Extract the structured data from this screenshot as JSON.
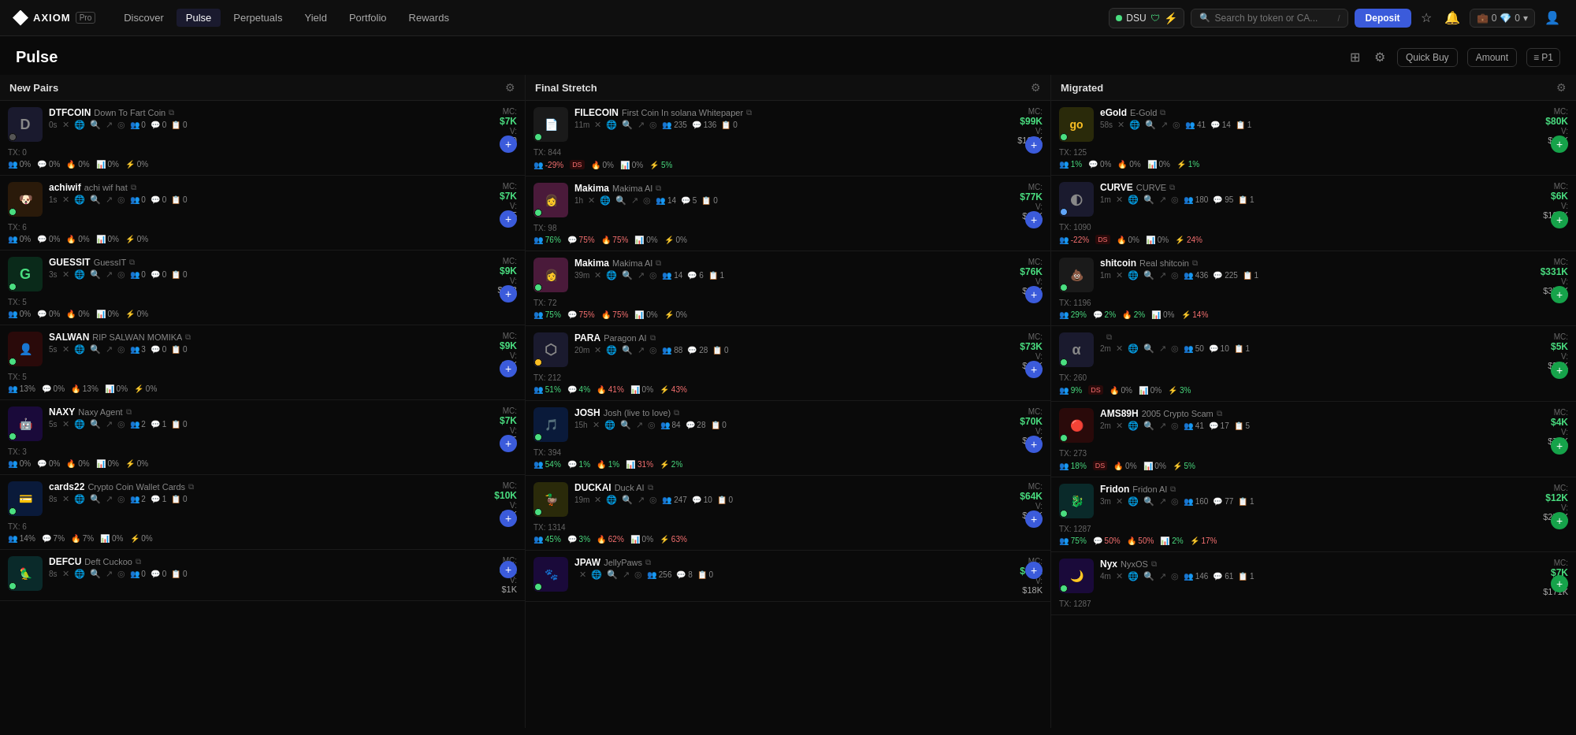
{
  "nav": {
    "logo": "AXIOM",
    "pro": "Pro",
    "links": [
      "Discover",
      "Pulse",
      "Perpetuals",
      "Yield",
      "Portfolio",
      "Rewards"
    ],
    "active_link": "Pulse",
    "wallet": "DSU",
    "search_placeholder": "Search by token or CA...",
    "search_shortcut": "/",
    "deposit_label": "Deposit",
    "balance_0": "0",
    "balance_1": "0"
  },
  "page": {
    "title": "Pulse",
    "quick_buy": "Quick Buy",
    "amount": "Amount",
    "pl": "≡ P1"
  },
  "columns": [
    {
      "id": "new-pairs",
      "title": "New Pairs",
      "tokens": [
        {
          "symbol": "DTFCOIN",
          "name": "Down To Fart Coin",
          "time": "0s",
          "mc": "$7K",
          "v": "$0",
          "tx": "0",
          "avatar_letter": "D",
          "avatar_class": "av-dark",
          "status_class": "status-gray",
          "counts": [
            0,
            0,
            0
          ],
          "stats": [
            "0%",
            "0%",
            "0%",
            "0%",
            "0%"
          ],
          "has_lightning": true
        },
        {
          "symbol": "achiwif",
          "name": "achi wif hat",
          "time": "1s",
          "mc": "$7K",
          "v": "$15",
          "tx": "6",
          "avatar_letter": "🐶",
          "avatar_class": "av-orange",
          "status_class": "status-green",
          "counts": [
            0,
            0,
            0
          ],
          "stats": [
            "0%",
            "0%",
            "0%",
            "0%",
            "0%"
          ],
          "has_lightning": true
        },
        {
          "symbol": "GUESSIT",
          "name": "GuessIT",
          "time": "3s",
          "mc": "$9K",
          "v": "$993",
          "tx": "5",
          "avatar_letter": "G",
          "avatar_class": "av-green",
          "status_class": "status-green",
          "counts": [
            0,
            0,
            0
          ],
          "stats": [
            "0%",
            "0%",
            "0%",
            "0%",
            "0%"
          ],
          "has_lightning": true
        },
        {
          "symbol": "SALWAN",
          "name": "RIP SALWAN MOMIKA",
          "time": "5s",
          "mc": "$9K",
          "v": "$2K",
          "tx": "5",
          "avatar_letter": "👤",
          "avatar_class": "av-red",
          "status_class": "status-green",
          "counts": [
            3,
            0,
            0
          ],
          "stats": [
            "13%",
            "0%",
            "13%",
            "0%",
            "0%"
          ],
          "has_lightning": true
        },
        {
          "symbol": "NAXY",
          "name": "Naxy Agent",
          "time": "5s",
          "mc": "$7K",
          "v": "$5",
          "tx": "3",
          "avatar_letter": "🤖",
          "avatar_class": "av-purple",
          "status_class": "status-green",
          "counts": [
            2,
            1,
            0
          ],
          "stats": [
            "0%",
            "0%",
            "0%",
            "0%",
            "0%"
          ],
          "has_lightning": true
        },
        {
          "symbol": "cards22",
          "name": "Crypto Coin Wallet Cards",
          "time": "8s",
          "mc": "$10K",
          "v": "$3K",
          "tx": "6",
          "avatar_letter": "💳",
          "avatar_class": "av-blue",
          "status_class": "status-green",
          "counts": [
            2,
            1,
            0
          ],
          "stats": [
            "14%",
            "7%",
            "7%",
            "0%",
            "0%"
          ],
          "has_lightning": true
        },
        {
          "symbol": "DEFCU",
          "name": "Deft Cuckoo",
          "time": "8s",
          "mc": "$7K",
          "v": "$1K",
          "tx": "",
          "avatar_letter": "🦜",
          "avatar_class": "av-teal",
          "status_class": "status-green",
          "counts": [
            0,
            0,
            0
          ],
          "stats": [],
          "has_lightning": true
        }
      ]
    },
    {
      "id": "final-stretch",
      "title": "Final Stretch",
      "tokens": [
        {
          "symbol": "FILECOIN",
          "name": "First Coin In solana Whitepaper",
          "time": "11m",
          "mc": "$99K",
          "v": "$127K",
          "tx": "844",
          "avatar_letter": "📄",
          "avatar_class": "av-gray",
          "status_class": "status-green",
          "counts": [
            235,
            136,
            0
          ],
          "stats": [
            "-29%",
            "DS",
            "0%",
            "0%",
            "5%"
          ],
          "stats_colors": [
            "red",
            "ds",
            "neutral",
            "neutral",
            "up"
          ],
          "has_lightning": true
        },
        {
          "symbol": "Makima",
          "name": "Makima AI",
          "time": "1h",
          "mc": "$77K",
          "v": "$23K",
          "tx": "98",
          "avatar_letter": "👩",
          "avatar_class": "av-pink",
          "status_class": "status-green",
          "counts": [
            14,
            5,
            0
          ],
          "stats": [
            "76%",
            "75%",
            "75%",
            "0%",
            "0%"
          ],
          "stats_colors": [
            "up",
            "down",
            "down",
            "neutral",
            "neutral"
          ],
          "has_lightning": true
        },
        {
          "symbol": "Makima",
          "name": "Makima AI",
          "time": "39m",
          "mc": "$76K",
          "v": "$21K",
          "tx": "72",
          "avatar_letter": "👩",
          "avatar_class": "av-pink",
          "status_class": "status-green",
          "counts": [
            14,
            6,
            1
          ],
          "stats": [
            "75%",
            "75%",
            "75%",
            "0%",
            "0%"
          ],
          "stats_colors": [
            "up",
            "down",
            "down",
            "neutral",
            "neutral"
          ],
          "has_lightning": true
        },
        {
          "symbol": "PARA",
          "name": "Paragon AI",
          "time": "20m",
          "mc": "$73K",
          "v": "$44K",
          "tx": "212",
          "avatar_letter": "⬡",
          "avatar_class": "av-dark",
          "status_class": "status-yellow",
          "counts": [
            88,
            28,
            0
          ],
          "stats": [
            "51%",
            "4%",
            "41%",
            "0%",
            "43%"
          ],
          "stats_colors": [
            "up",
            "up",
            "down",
            "neutral",
            "down"
          ],
          "has_lightning": true
        },
        {
          "symbol": "JOSH",
          "name": "Josh (live to love)",
          "time": "15h",
          "mc": "$70K",
          "v": "$30K",
          "tx": "394",
          "avatar_letter": "🎵",
          "avatar_class": "av-blue",
          "status_class": "status-green",
          "counts": [
            84,
            28,
            0
          ],
          "stats": [
            "54%",
            "1%",
            "1%",
            "31%",
            "2%"
          ],
          "stats_colors": [
            "up",
            "up",
            "up",
            "down",
            "up"
          ],
          "has_lightning": true
        },
        {
          "symbol": "DUCKAI",
          "name": "Duck AI",
          "time": "19m",
          "mc": "$64K",
          "v": "$18K",
          "tx": "1314",
          "avatar_letter": "🦆",
          "avatar_class": "av-yellow",
          "status_class": "status-green",
          "counts": [
            247,
            10,
            0
          ],
          "stats": [
            "45%",
            "3%",
            "62%",
            "0%",
            "63%"
          ],
          "stats_colors": [
            "up",
            "up",
            "down",
            "neutral",
            "down"
          ],
          "has_lightning": true
        },
        {
          "symbol": "JPAW",
          "name": "JellyPaws",
          "time": "",
          "mc": "$61K",
          "v": "$18K",
          "tx": "",
          "avatar_letter": "🐾",
          "avatar_class": "av-purple",
          "status_class": "status-green",
          "counts": [
            256,
            8,
            0
          ],
          "stats": [],
          "has_lightning": true
        }
      ]
    },
    {
      "id": "migrated",
      "title": "Migrated",
      "tokens": [
        {
          "symbol": "eGold",
          "name": "E-Gold",
          "time": "58s",
          "mc": "$80K",
          "v": "$47K",
          "tx": "125",
          "avatar_letter": "go",
          "avatar_class": "av-yellow",
          "status_class": "status-green",
          "counts": [
            41,
            14,
            1
          ],
          "stats": [
            "1%",
            "0%",
            "0%",
            "0%",
            "1%"
          ],
          "stats_colors": [
            "up",
            "neutral",
            "neutral",
            "neutral",
            "up"
          ],
          "has_lightning": true
        },
        {
          "symbol": "CURVE",
          "name": "CURVE",
          "time": "1m",
          "mc": "$6K",
          "v": "$182K",
          "tx": "1090",
          "avatar_letter": "◐",
          "avatar_class": "av-dark",
          "status_class": "status-blue",
          "counts": [
            180,
            95,
            1
          ],
          "stats": [
            "-22%",
            "DS",
            "0%",
            "0%",
            "24%"
          ],
          "stats_colors": [
            "red",
            "ds",
            "neutral",
            "neutral",
            "down"
          ],
          "has_lightning": true
        },
        {
          "symbol": "shitcoin",
          "name": "Real shitcoin",
          "time": "1m",
          "mc": "$331K",
          "v": "$372K",
          "tx": "1196",
          "avatar_letter": "💩",
          "avatar_class": "av-gray",
          "status_class": "status-green",
          "counts": [
            436,
            225,
            1
          ],
          "stats": [
            "29%",
            "2%",
            "2%",
            "0%",
            "14%"
          ],
          "stats_colors": [
            "up",
            "up",
            "up",
            "neutral",
            "down"
          ],
          "has_lightning": true
        },
        {
          "symbol": "",
          "name": "",
          "time": "2m",
          "mc": "$5K",
          "v": "$56K",
          "tx": "260",
          "avatar_letter": "α",
          "avatar_class": "av-dark",
          "status_class": "status-green",
          "counts": [
            50,
            10,
            1
          ],
          "stats": [
            "9%",
            "DS",
            "0%",
            "0%",
            "3%"
          ],
          "stats_colors": [
            "up",
            "ds",
            "neutral",
            "neutral",
            "up"
          ],
          "has_lightning": true
        },
        {
          "symbol": "AMS89H",
          "name": "2005 Crypto Scam",
          "time": "2m",
          "mc": "$4K",
          "v": "$72K",
          "tx": "273",
          "avatar_letter": "🔴",
          "avatar_class": "av-red",
          "status_class": "status-green",
          "counts": [
            41,
            17,
            5
          ],
          "stats": [
            "18%",
            "DS",
            "0%",
            "0%",
            "5%"
          ],
          "stats_colors": [
            "up",
            "ds",
            "neutral",
            "neutral",
            "up"
          ],
          "has_lightning": true
        },
        {
          "symbol": "Fridon",
          "name": "Fridon AI",
          "time": "3m",
          "mc": "$12K",
          "v": "$259K",
          "tx": "1287",
          "avatar_letter": "🐉",
          "avatar_class": "av-teal",
          "status_class": "status-green",
          "counts": [
            160,
            77,
            1
          ],
          "stats": [
            "75%",
            "50%",
            "50%",
            "2%",
            "17%"
          ],
          "stats_colors": [
            "up",
            "down",
            "down",
            "up",
            "down"
          ],
          "has_lightning": true
        },
        {
          "symbol": "Nyx",
          "name": "NyxOS",
          "time": "4m",
          "mc": "$7K",
          "v": "$171K",
          "tx": "1287",
          "avatar_letter": "🌙",
          "avatar_class": "av-purple",
          "status_class": "status-green",
          "counts": [
            146,
            61,
            1
          ],
          "stats": [],
          "has_lightning": true
        }
      ]
    }
  ]
}
